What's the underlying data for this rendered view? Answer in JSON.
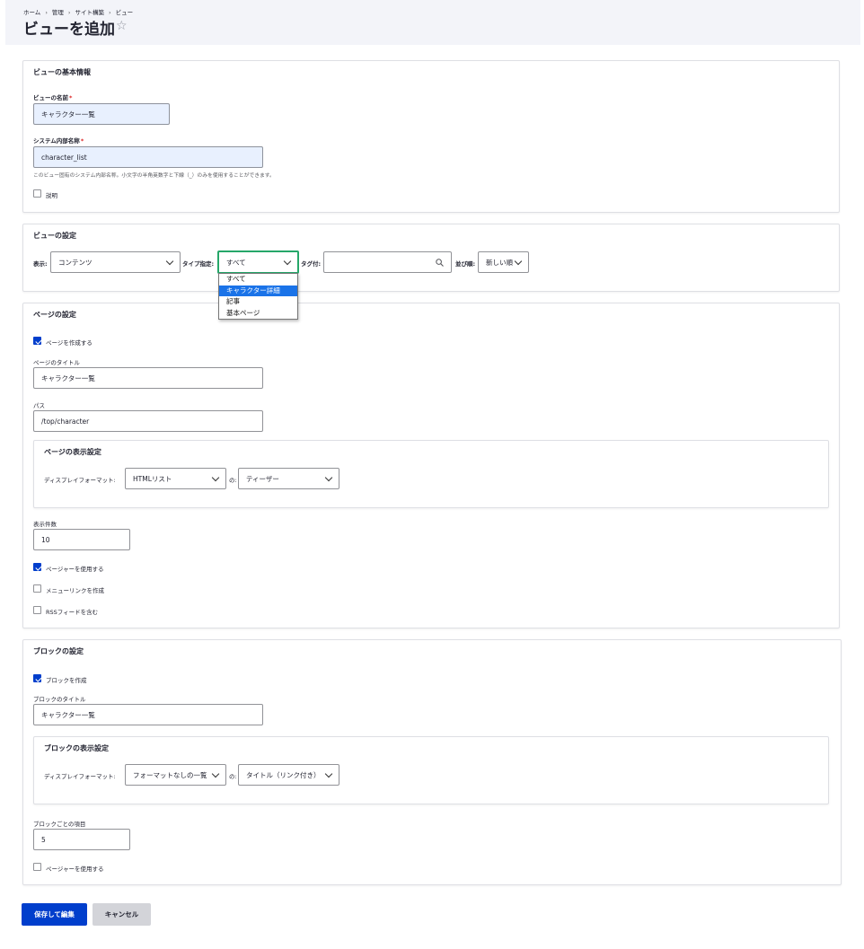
{
  "breadcrumb": [
    "ホーム",
    "管理",
    "サイト構築",
    "ビュー"
  ],
  "page_title": "ビューを追加",
  "basic": {
    "title": "ビューの基本情報",
    "name_label": "ビューの名前",
    "name_value": "キャラクター一覧",
    "machine_label": "システム内部名称",
    "machine_value": "character_list",
    "machine_help": "このビュー固有のシステム内部名称。小文字の半角英数字と下線（_）のみを使用することができます。",
    "description_label": "説明",
    "required_mark": "*"
  },
  "view_settings": {
    "title": "ビューの設定",
    "show_label": "表示:",
    "show_value": "コンテンツ",
    "type_label": "タイプ指定:",
    "type_value": "すべて",
    "type_options": [
      "すべて",
      "キャラクター詳細",
      "記事",
      "基本ページ"
    ],
    "type_selected_index": 1,
    "tag_label": "タグ付:",
    "tag_value": "",
    "sort_label": "並び順:",
    "sort_value": "新しい順"
  },
  "page_settings": {
    "title": "ページの設定",
    "create_label": "ページを作成する",
    "create_checked": true,
    "page_title_label": "ページのタイトル",
    "page_title_value": "キャラクター一覧",
    "path_label": "パス",
    "path_value": "/top/character",
    "display": {
      "title": "ページの表示設定",
      "format_label": "ディスプレイフォーマット:",
      "format_value": "HTMLリスト",
      "of_label": "の:",
      "of_value": "ティーザー"
    },
    "items_label": "表示件数",
    "items_value": "10",
    "pager_label": "ページャーを使用する",
    "pager_checked": true,
    "menu_label": "メニューリンクを作成",
    "menu_checked": false,
    "rss_label": "RSSフィードを含む",
    "rss_checked": false
  },
  "block_settings": {
    "title": "ブロックの設定",
    "create_label": "ブロックを作成",
    "create_checked": true,
    "block_title_label": "ブロックのタイトル",
    "block_title_value": "キャラクター一覧",
    "display": {
      "title": "ブロックの表示設定",
      "format_label": "ディスプレイフォーマット:",
      "format_value": "フォーマットなしの一覧",
      "of_label": "の:",
      "of_value": "タイトル（リンク付き）"
    },
    "items_label": "ブロックごとの項目",
    "items_value": "5",
    "pager_label": "ページャーを使用する",
    "pager_checked": false
  },
  "actions": {
    "save_label": "保存して編集",
    "cancel_label": "キャンセル"
  },
  "colors": {
    "primary": "#003ecc",
    "focus": "#26a769",
    "header_bg": "#f3f4f9",
    "autofill_bg": "#e8f0fe"
  },
  "icons": {
    "star": "star-outline-icon",
    "search": "search-icon",
    "chevron": "chevron-down-icon",
    "check": "checkmark-icon"
  }
}
